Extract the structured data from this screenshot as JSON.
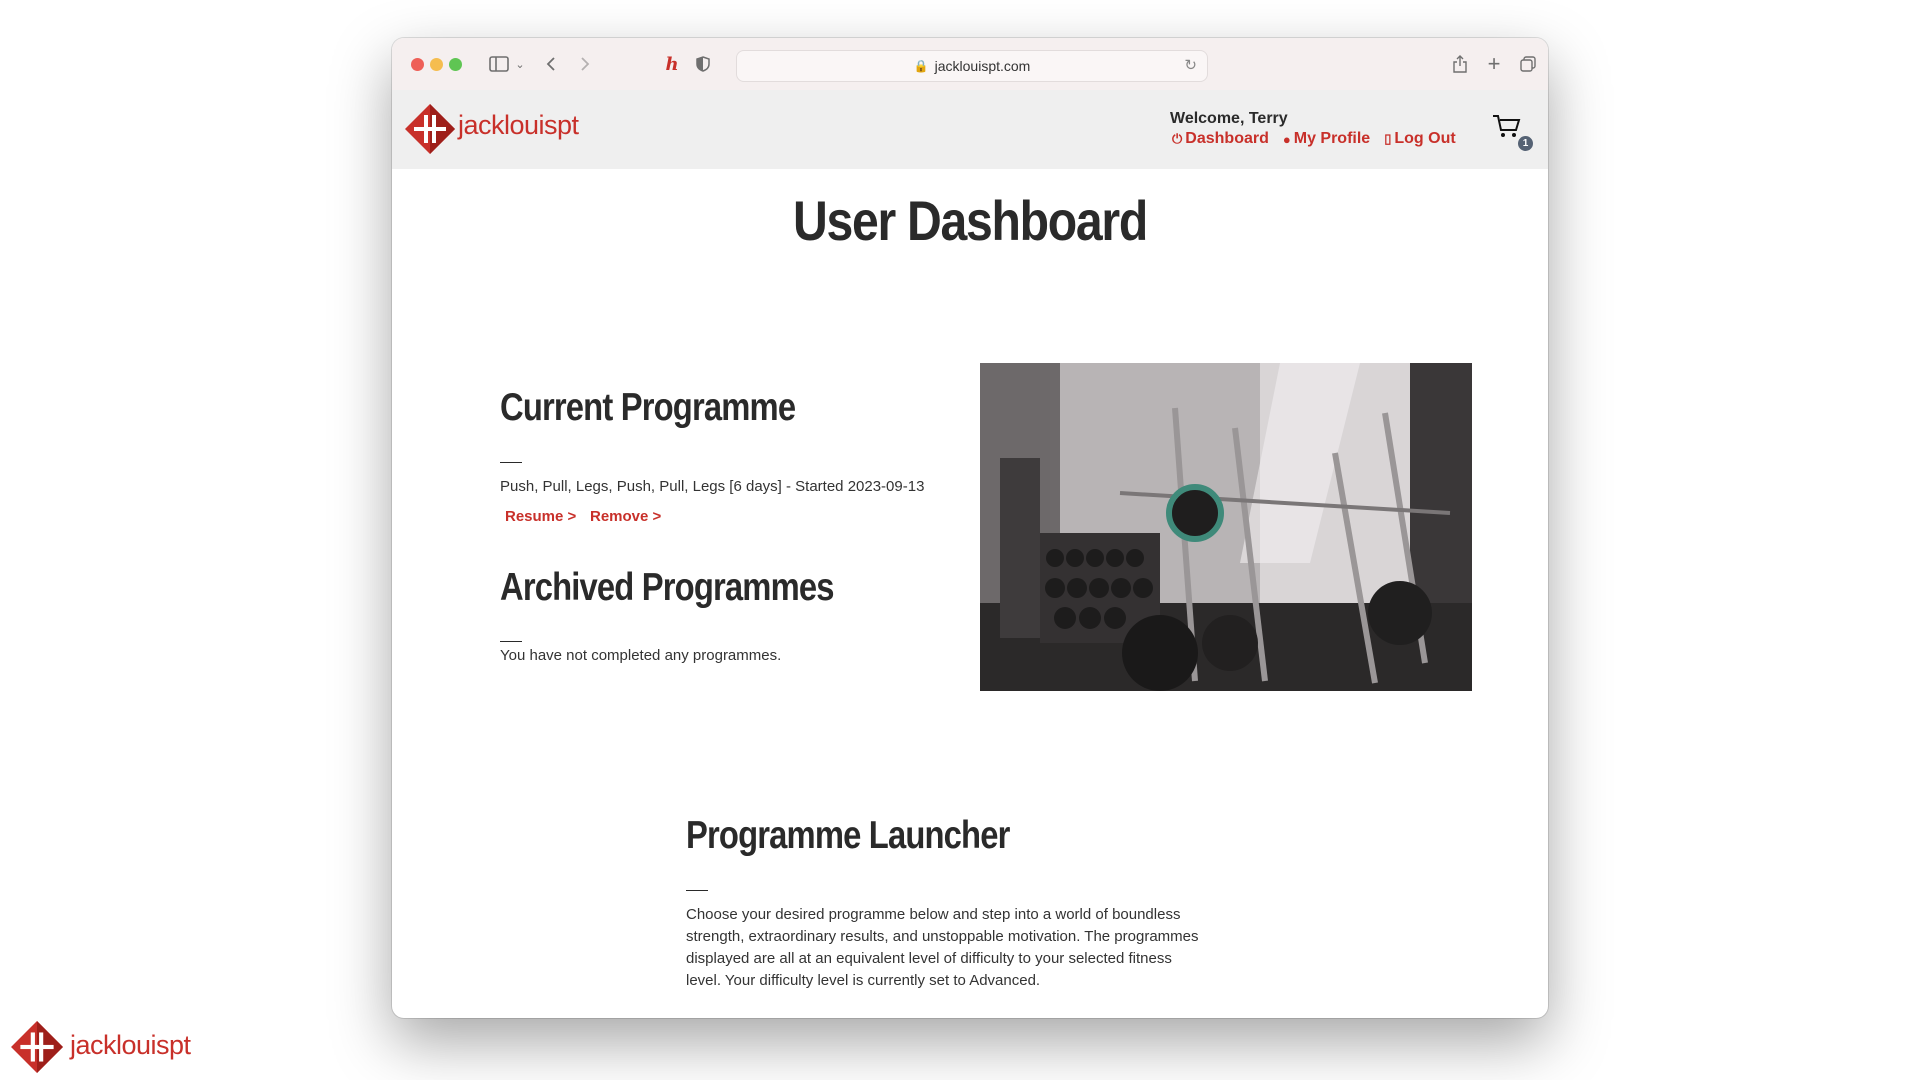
{
  "browser": {
    "url": "jacklouispt.com"
  },
  "header": {
    "logo_text": "jacklouispt",
    "welcome": "Welcome, Terry",
    "nav": [
      {
        "label": "Dashboard",
        "icon": "power-icon"
      },
      {
        "label": "My Profile",
        "icon": "user-circle-icon"
      },
      {
        "label": "Log Out",
        "icon": "door-icon"
      }
    ],
    "cart_count": "1"
  },
  "main": {
    "title": "User Dashboard",
    "current": {
      "heading": "Current Programme",
      "programme": "Push, Pull, Legs, Push, Pull, Legs [6 days] - Started 2023-09-13",
      "resume_label": "Resume >",
      "remove_label": "Remove >"
    },
    "archived": {
      "heading": "Archived Programmes",
      "empty_text": "You have not completed any programmes."
    },
    "launcher": {
      "heading": "Programme Launcher",
      "lines": [
        "Choose your desired programme below and step into a world of boundless",
        "strength, extraordinary results, and unstoppable motivation. The programmes",
        "displayed are all at an equivalent level of difficulty to your selected fitness",
        "level. Your difficulty level is currently set to Advanced."
      ]
    }
  },
  "footer": {
    "logo_text": "jacklouispt"
  },
  "colors": {
    "brand_red": "#c8302a",
    "dark_text": "#2a2a2a",
    "header_bg": "#efefef"
  }
}
